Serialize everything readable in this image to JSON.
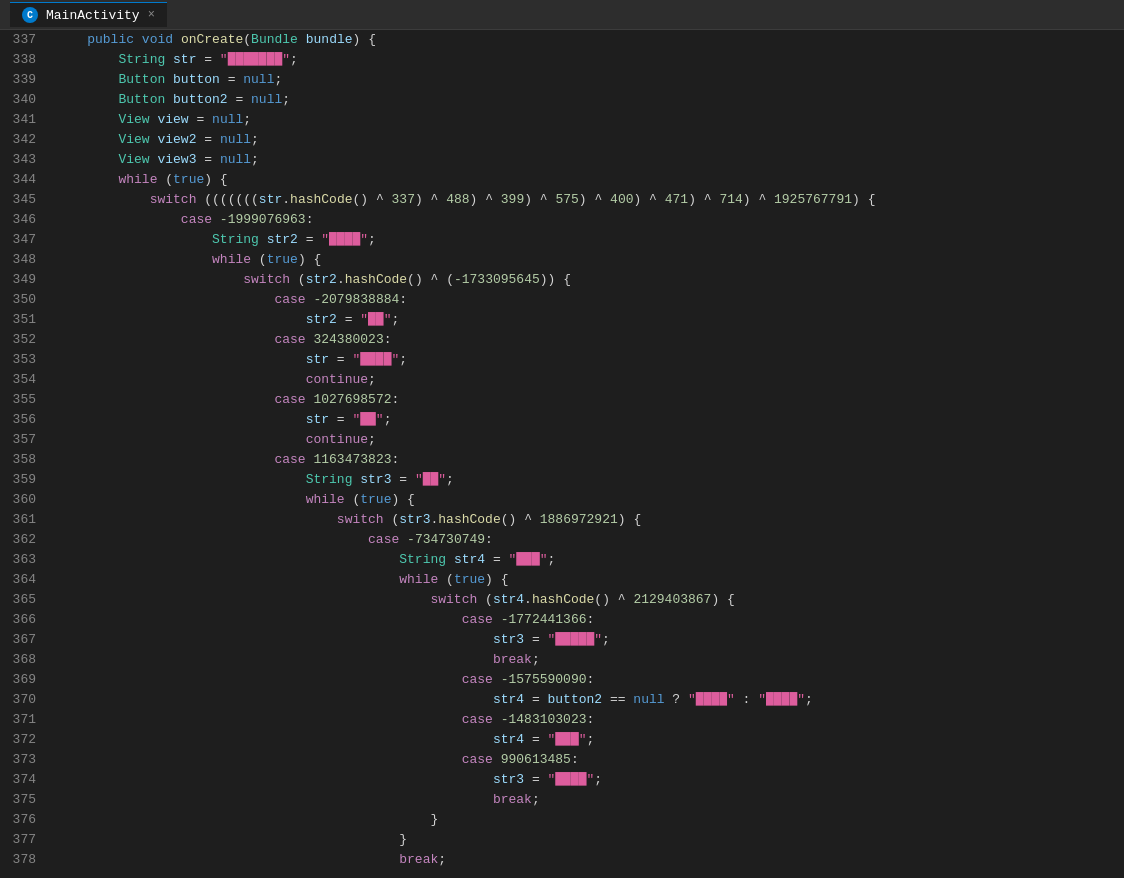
{
  "tab": {
    "title": "MainActivity",
    "icon": "C",
    "close": "×"
  },
  "lines": [
    {
      "num": 337,
      "indent": 1,
      "content": "public_void_onCreate"
    },
    {
      "num": 338
    },
    {
      "num": 339
    },
    {
      "num": 340
    },
    {
      "num": 341
    },
    {
      "num": 342
    },
    {
      "num": 343
    },
    {
      "num": 344
    },
    {
      "num": 345
    },
    {
      "num": 346
    },
    {
      "num": 347
    },
    {
      "num": 348
    },
    {
      "num": 349
    },
    {
      "num": 350
    },
    {
      "num": 351
    },
    {
      "num": 352
    },
    {
      "num": 353
    },
    {
      "num": 354
    },
    {
      "num": 355
    },
    {
      "num": 356
    },
    {
      "num": 357
    },
    {
      "num": 358
    },
    {
      "num": 359
    },
    {
      "num": 360
    },
    {
      "num": 361
    },
    {
      "num": 362
    },
    {
      "num": 363
    },
    {
      "num": 364
    },
    {
      "num": 365
    },
    {
      "num": 366
    },
    {
      "num": 367
    },
    {
      "num": 368
    },
    {
      "num": 369
    },
    {
      "num": 370
    },
    {
      "num": 371
    },
    {
      "num": 372
    },
    {
      "num": 373
    },
    {
      "num": 374
    },
    {
      "num": 375
    },
    {
      "num": 376
    },
    {
      "num": 377
    },
    {
      "num": 378
    }
  ],
  "colors": {
    "bg": "#1e1e1e",
    "titlebar": "#2d2d2d",
    "accent": "#007acc",
    "linenum": "#858585"
  }
}
